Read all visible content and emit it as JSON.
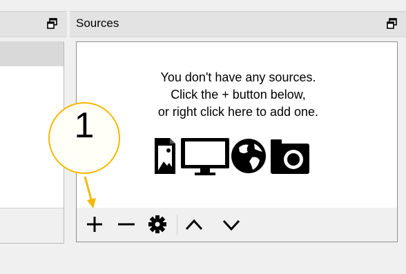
{
  "scenes_dock": {
    "undock_icon": "float-window-icon"
  },
  "sources_dock": {
    "title": "Sources",
    "undock_icon": "float-window-icon",
    "empty_state": {
      "line1": "You don't have any sources.",
      "line2": "Click the + button below,",
      "line3": "or right click here to add one.",
      "icons": [
        "image-icon",
        "display-monitor-icon",
        "globe-icon",
        "camera-icon"
      ]
    },
    "toolbar": {
      "buttons": [
        "add-icon",
        "remove-icon",
        "gear-icon",
        "move-up-icon",
        "move-down-icon"
      ]
    }
  },
  "callout": {
    "number": "1",
    "color": "#f5b800"
  }
}
